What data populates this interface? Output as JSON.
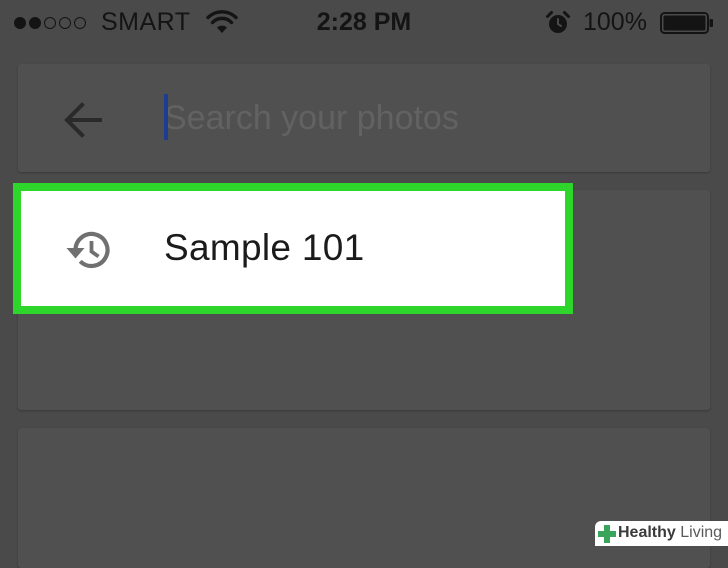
{
  "status_bar": {
    "signal": {
      "filled": 2,
      "total": 5
    },
    "carrier": "SMART",
    "wifi_icon": "wifi-icon",
    "time": "2:28 PM",
    "alarm_icon": "alarm-clock-icon",
    "battery_percent": "100%",
    "battery_level": 1.0
  },
  "search": {
    "back_icon": "back-arrow-icon",
    "value": "",
    "placeholder": "Search your photos",
    "caret_color": "#1d3d93"
  },
  "suggestions": [
    {
      "icon": "history-icon",
      "label": "Sample 101"
    }
  ],
  "highlight_color": "#2ed52b",
  "watermark": {
    "strong": "Healthy",
    "light": "Living",
    "icon": "plus-cross-icon"
  }
}
